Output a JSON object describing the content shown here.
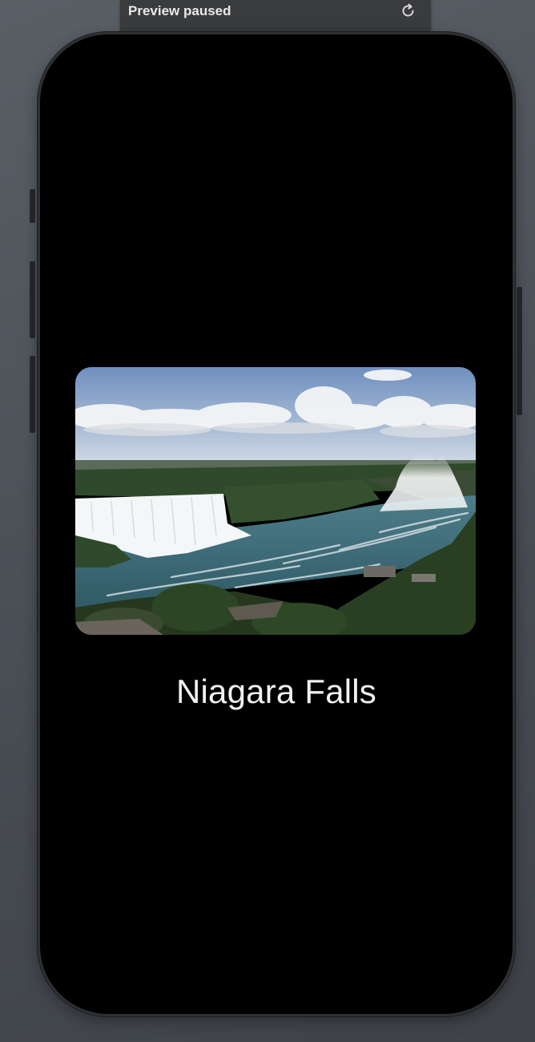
{
  "preview_bar": {
    "status_label": "Preview paused",
    "refresh_icon": "refresh-icon"
  },
  "content": {
    "image_icon": "waterfall-photo",
    "title": "Niagara Falls"
  },
  "colors": {
    "screen_background": "#000000",
    "title_text": "#f2f2f2",
    "canvas_background": "#4f545b"
  }
}
